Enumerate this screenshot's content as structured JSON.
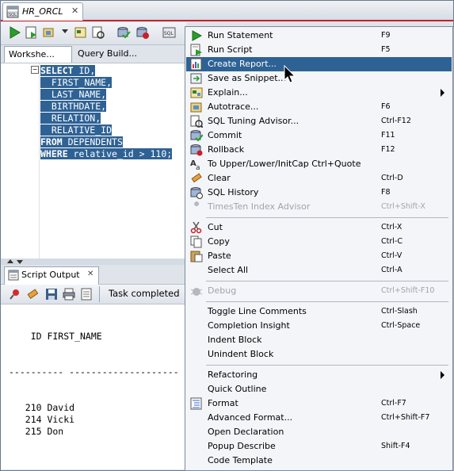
{
  "tab": {
    "title": "HR_ORCL",
    "close": "✕"
  },
  "subtabs": {
    "worksheet": "Workshe...",
    "query_builder": "Query Build..."
  },
  "editor": {
    "lines": [
      {
        "kw": "SELECT",
        "rest": " ID,"
      },
      {
        "kw": "",
        "rest": "  FIRST_NAME,"
      },
      {
        "kw": "",
        "rest": "  LAST_NAME,"
      },
      {
        "kw": "",
        "rest": "  BIRTHDATE,"
      },
      {
        "kw": "",
        "rest": "  RELATION,"
      },
      {
        "kw": "",
        "rest": "  RELATIVE_ID"
      },
      {
        "kw": "FROM",
        "rest": " DEPENDENTS"
      },
      {
        "kw": "WHERE",
        "rest": " relative_id > 110;"
      }
    ],
    "fold": "−"
  },
  "output": {
    "tab_label": "Script Output",
    "tab_close": "✕",
    "status": "Task completed",
    "header": "    ID FIRST_NAME",
    "rule": "---------- --------------------",
    "rows": [
      "   210 David",
      "   214 Vicki",
      "   215 Don"
    ]
  },
  "menu": {
    "items": [
      {
        "label": "Run Statement",
        "shortcut": "F9",
        "icon": "run-icon"
      },
      {
        "label": "Run Script",
        "shortcut": "F5",
        "icon": "run-script-icon"
      },
      {
        "label": "Create Report...",
        "shortcut": "",
        "icon": "report-icon",
        "highlighted": true
      },
      {
        "label": "Save as Snippet...",
        "shortcut": "",
        "icon": "snippet-icon"
      },
      {
        "label": "Explain...",
        "shortcut": "",
        "icon": "explain-icon",
        "submenu": true
      },
      {
        "label": "Autotrace...",
        "shortcut": "F6",
        "icon": "autotrace-icon"
      },
      {
        "label": "SQL Tuning Advisor...",
        "shortcut": "Ctrl-F12",
        "icon": "tuning-icon"
      },
      {
        "label": "Commit",
        "shortcut": "F11",
        "icon": "commit-icon"
      },
      {
        "label": "Rollback",
        "shortcut": "F12",
        "icon": "rollback-icon"
      },
      {
        "label": "To Upper/Lower/InitCap    Ctrl+Quote",
        "shortcut": "",
        "icon": "case-icon"
      },
      {
        "label": "Clear",
        "shortcut": "Ctrl-D",
        "icon": "clear-icon"
      },
      {
        "label": "SQL History",
        "shortcut": "F8",
        "icon": "history-icon"
      },
      {
        "label": "TimesTen Index Advisor",
        "shortcut": "Ctrl+Shift-X",
        "icon": "wrench-icon",
        "disabled": true
      },
      {
        "sep": true
      },
      {
        "label": "Cut",
        "shortcut": "Ctrl-X",
        "icon": "cut-icon"
      },
      {
        "label": "Copy",
        "shortcut": "Ctrl-C",
        "icon": "copy-icon"
      },
      {
        "label": "Paste",
        "shortcut": "Ctrl-V",
        "icon": "paste-icon"
      },
      {
        "label": "Select All",
        "shortcut": "Ctrl-A",
        "icon": ""
      },
      {
        "sep": true
      },
      {
        "label": "Debug",
        "shortcut": "Ctrl+Shift-F10",
        "icon": "debug-icon",
        "disabled": true
      },
      {
        "sep": true
      },
      {
        "label": "Toggle Line Comments",
        "shortcut": "Ctrl-Slash",
        "icon": ""
      },
      {
        "label": "Completion Insight",
        "shortcut": "Ctrl-Space",
        "icon": ""
      },
      {
        "label": "Indent Block",
        "shortcut": "",
        "icon": ""
      },
      {
        "label": "Unindent Block",
        "shortcut": "",
        "icon": ""
      },
      {
        "sep": true
      },
      {
        "label": "Refactoring",
        "shortcut": "",
        "icon": "",
        "submenu": true
      },
      {
        "label": "Quick Outline",
        "shortcut": "",
        "icon": ""
      },
      {
        "label": "Format",
        "shortcut": "Ctrl-F7",
        "icon": "format-icon"
      },
      {
        "label": "Advanced Format...",
        "shortcut": "Ctrl+Shift-F7",
        "icon": ""
      },
      {
        "label": "Open Declaration",
        "shortcut": "",
        "icon": ""
      },
      {
        "label": "Popup Describe",
        "shortcut": "Shift-F4",
        "icon": ""
      },
      {
        "label": "Code Template",
        "shortcut": "",
        "icon": ""
      }
    ]
  },
  "colors": {
    "selection": "#2f6294",
    "accent_red": "#c8202a",
    "run_green": "#2a9d2a"
  }
}
